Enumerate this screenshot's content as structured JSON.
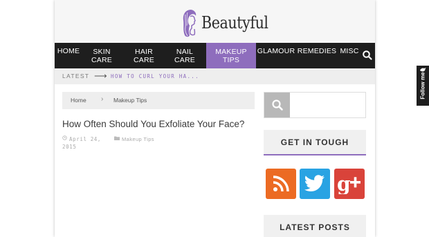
{
  "brand": {
    "name": "Beautyful",
    "accent": "#8e6dbd"
  },
  "nav": {
    "items": [
      {
        "id": "home",
        "line1": "HOME",
        "line2": ""
      },
      {
        "id": "skin-care",
        "line1": "SKIN",
        "line2": "CARE"
      },
      {
        "id": "hair-care",
        "line1": "HAIR",
        "line2": "CARE"
      },
      {
        "id": "nail-care",
        "line1": "NAIL",
        "line2": "CARE"
      },
      {
        "id": "makeup-tips",
        "line1": "MAKEUP",
        "line2": "TIPS",
        "active": true
      },
      {
        "id": "glamour",
        "line1": "GLAMOUR",
        "line2": ""
      },
      {
        "id": "remedies",
        "line1": "REMEDIES",
        "line2": ""
      },
      {
        "id": "misc",
        "line1": "MISC",
        "line2": ""
      }
    ],
    "search_icon": "search-icon"
  },
  "latest": {
    "label": "LATEST",
    "arrow": "⟶",
    "headline": "HOW TO CURL YOUR HA..."
  },
  "breadcrumb": {
    "home": "Home",
    "separator": "›",
    "category": "Makeup Tips"
  },
  "post": {
    "title": "How Often Should You Exfoliate Your Face?",
    "date": "April 24, 2015",
    "category": "Makeup Tips"
  },
  "sidebar": {
    "search_placeholder": "",
    "get_in_touch": "GET IN TOUGH",
    "social": [
      "rss-icon",
      "twitter-icon",
      "google-plus-icon"
    ],
    "latest_posts": "LATEST POSTS"
  },
  "follow": {
    "label": "Follow me"
  }
}
